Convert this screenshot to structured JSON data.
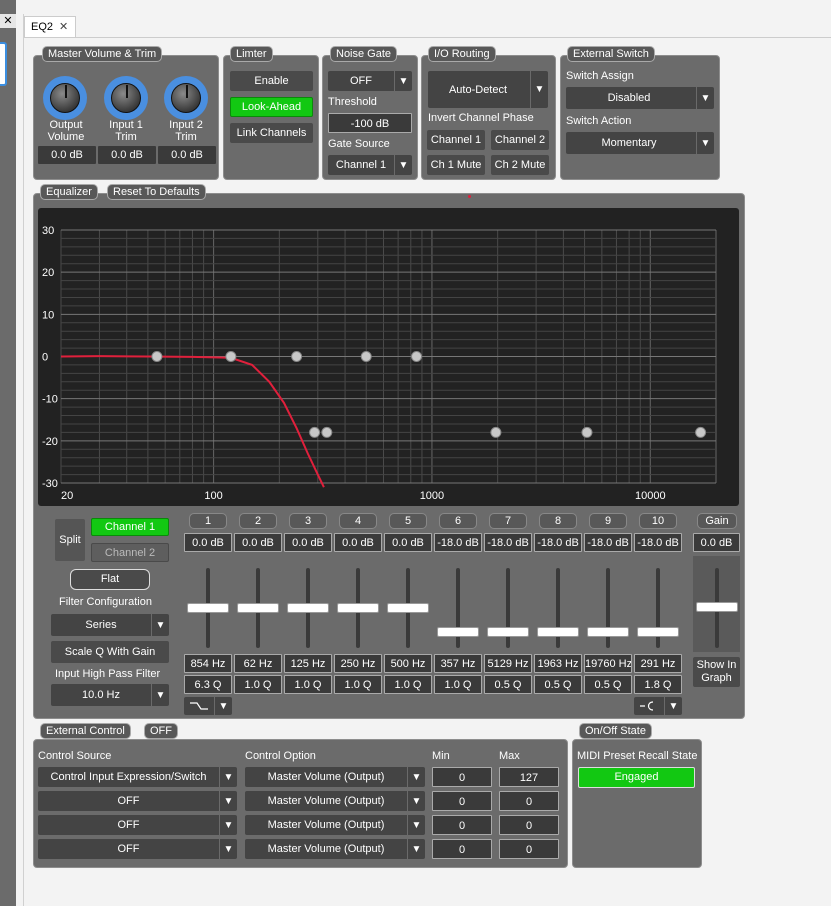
{
  "window": {
    "close_glyph": "✕",
    "tab": {
      "label": "EQ2",
      "close": "✕"
    }
  },
  "master": {
    "title": "Master Volume & Trim",
    "knobs": [
      {
        "label": "Output\nVolume",
        "value": "0.0 dB"
      },
      {
        "label": "Input 1\nTrim",
        "value": "0.0 dB"
      },
      {
        "label": "Input 2\nTrim",
        "value": "0.0 dB"
      }
    ]
  },
  "limiter": {
    "title": "Limter",
    "enable": "Enable",
    "look_ahead": "Look-Ahead",
    "link": "Link Channels"
  },
  "gate": {
    "title": "Noise Gate",
    "state": "OFF",
    "threshold_label": "Threshold",
    "threshold": "-100 dB",
    "source_label": "Gate Source",
    "source": "Channel 1"
  },
  "io": {
    "title": "I/O Routing",
    "mode": "Auto-Detect",
    "invert_label": "Invert Channel Phase",
    "ch1": "Channel 1",
    "ch2": "Channel 2",
    "ch1mute": "Ch 1 Mute",
    "ch2mute": "Ch 2 Mute"
  },
  "ext_switch": {
    "title": "External Switch",
    "assign_label": "Switch Assign",
    "assign": "Disabled",
    "action_label": "Switch Action",
    "action": "Momentary"
  },
  "eq": {
    "title": "Equalizer",
    "reset": "Reset To Defaults",
    "split": "Split",
    "ch1": "Channel 1",
    "ch2": "Channel 2",
    "flat": "Flat",
    "filter_cfg_label": "Filter Configuration",
    "filter_cfg": "Series",
    "scale_q": "Scale Q With Gain",
    "hpf_label": "Input High Pass Filter",
    "hpf": "10.0 Hz",
    "gain_label": "Gain",
    "gain_value": "0.0 dB",
    "show_graph": "Show In\nGraph",
    "bands": [
      {
        "num": "1",
        "gain": "0.0 dB",
        "freq": "854 Hz",
        "q": "6.3 Q",
        "level": 0.5
      },
      {
        "num": "2",
        "gain": "0.0 dB",
        "freq": "62 Hz",
        "q": "1.0 Q",
        "level": 0.5
      },
      {
        "num": "3",
        "gain": "0.0 dB",
        "freq": "125 Hz",
        "q": "1.0 Q",
        "level": 0.5
      },
      {
        "num": "4",
        "gain": "0.0 dB",
        "freq": "250 Hz",
        "q": "1.0 Q",
        "level": 0.5
      },
      {
        "num": "5",
        "gain": "0.0 dB",
        "freq": "500 Hz",
        "q": "1.0 Q",
        "level": 0.5
      },
      {
        "num": "6",
        "gain": "-18.0 dB",
        "freq": "357 Hz",
        "q": "1.0 Q",
        "level": 0.2
      },
      {
        "num": "7",
        "gain": "-18.0 dB",
        "freq": "5129 Hz",
        "q": "0.5 Q",
        "level": 0.2
      },
      {
        "num": "8",
        "gain": "-18.0 dB",
        "freq": "1963 Hz",
        "q": "0.5 Q",
        "level": 0.2
      },
      {
        "num": "9",
        "gain": "-18.0 dB",
        "freq": "19760 Hz",
        "q": "0.5 Q",
        "level": 0.2
      },
      {
        "num": "10",
        "gain": "-18.0 dB",
        "freq": "291 Hz",
        "q": "1.8 Q",
        "level": 0.2
      }
    ]
  },
  "chart_data": {
    "type": "line",
    "x_scale": "log",
    "xlim": [
      20,
      20000
    ],
    "ylim": [
      -30,
      30
    ],
    "x_ticks": [
      {
        "v": 20,
        "label": "20"
      },
      {
        "v": 100,
        "label": "100"
      },
      {
        "v": 1000,
        "label": "1000"
      },
      {
        "v": 10000,
        "label": "10000"
      }
    ],
    "y_ticks": [
      30,
      20,
      10,
      0,
      -10,
      -20,
      -30
    ],
    "grid": true,
    "curve_color": "#e0203c",
    "series": [
      {
        "x": [
          20,
          30,
          50,
          80,
          120,
          150,
          180,
          210,
          240,
          270,
          300,
          320
        ],
        "y": [
          0,
          0.1,
          0,
          -0.1,
          -0.3,
          -2,
          -6,
          -11,
          -17,
          -23,
          -28,
          -31
        ]
      }
    ],
    "band_points": [
      {
        "x": 55,
        "y": 0
      },
      {
        "x": 120,
        "y": 0
      },
      {
        "x": 240,
        "y": 0
      },
      {
        "x": 500,
        "y": 0
      },
      {
        "x": 850,
        "y": 0
      },
      {
        "x": 290,
        "y": -18
      },
      {
        "x": 330,
        "y": -18
      },
      {
        "x": 1963,
        "y": -18
      },
      {
        "x": 5129,
        "y": -18
      },
      {
        "x": 17000,
        "y": -18
      }
    ]
  },
  "ext_control": {
    "title": "External Control",
    "state": "OFF",
    "src_label": "Control Source",
    "opt_label": "Control Option",
    "min_label": "Min",
    "max_label": "Max",
    "rows": [
      {
        "source": "Control Input Expression/Switch",
        "option": "Master Volume (Output)",
        "min": "0",
        "max": "127"
      },
      {
        "source": "OFF",
        "option": "Master Volume (Output)",
        "min": "0",
        "max": "0"
      },
      {
        "source": "OFF",
        "option": "Master Volume (Output)",
        "min": "0",
        "max": "0"
      },
      {
        "source": "OFF",
        "option": "Master Volume (Output)",
        "min": "0",
        "max": "0"
      }
    ]
  },
  "onoff": {
    "title": "On/Off State",
    "midi_label": "MIDI Preset Recall State",
    "midi": "Engaged"
  },
  "icons": {
    "dropdown": "▼"
  },
  "colors": {
    "accent_green": "#12c812",
    "curve": "#e0203c",
    "knob_ring": "#4a8fe0"
  }
}
